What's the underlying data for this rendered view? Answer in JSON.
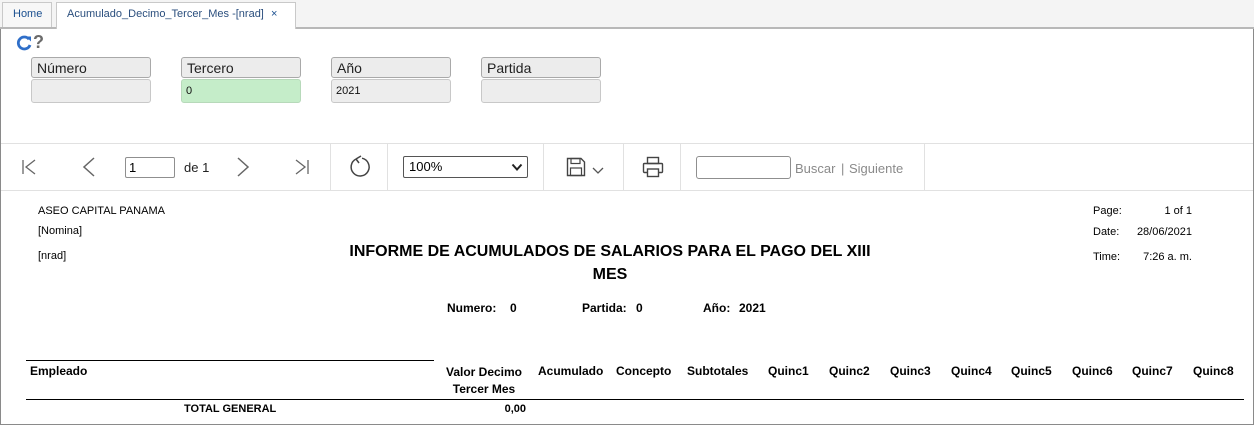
{
  "tabs": [
    {
      "label": "Home"
    },
    {
      "label": "Acumulado_Decimo_Tercer_Mes -[nrad]",
      "close": "×"
    }
  ],
  "params": {
    "numero": {
      "label": "Número",
      "value": ""
    },
    "tercero": {
      "label": "Tercero",
      "value": "0"
    },
    "anio": {
      "label": "Año",
      "value": "2021"
    },
    "partida": {
      "label": "Partida",
      "value": ""
    }
  },
  "toolbar": {
    "page_current": "1",
    "page_of": "de 1",
    "zoom": "100%",
    "search_value": "",
    "buscar": "Buscar",
    "siguiente": "Siguiente",
    "search_sep": "|"
  },
  "report": {
    "company": "ASEO CAPITAL PANAMA",
    "nomina": "[Nomina]",
    "user": "[nrad]",
    "title_line1": "INFORME DE ACUMULADOS DE SALARIOS PARA EL PAGO DEL XIII",
    "title_line2": "MES",
    "page_label": "Page:",
    "page_value": "1 of 1",
    "date_label": "Date:",
    "date_value": "28/06/2021",
    "time_label": "Time:",
    "time_value": "7:26 a. m.",
    "numero_label": "Numero:",
    "numero_value": "0",
    "partida_label": "Partida:",
    "partida_value": "0",
    "anio_label": "Año:",
    "anio_value": "2021",
    "columns": {
      "empleado": "Empleado",
      "valor_line1": "Valor Decimo",
      "valor_line2": "Tercer Mes",
      "acumulado": "Acumulado",
      "concepto": "Concepto",
      "subtotales": "Subtotales",
      "quinc1": "Quinc1",
      "quinc2": "Quinc2",
      "quinc3": "Quinc3",
      "quinc4": "Quinc4",
      "quinc5": "Quinc5",
      "quinc6": "Quinc6",
      "quinc7": "Quinc7",
      "quinc8": "Quinc8"
    },
    "total_label": "TOTAL GENERAL",
    "total_value": "0,00"
  },
  "colors": {
    "tab_text": "#1a4f8f",
    "refresh_icon": "#2f6fc9",
    "tercero_bg": "#c5edc9"
  }
}
